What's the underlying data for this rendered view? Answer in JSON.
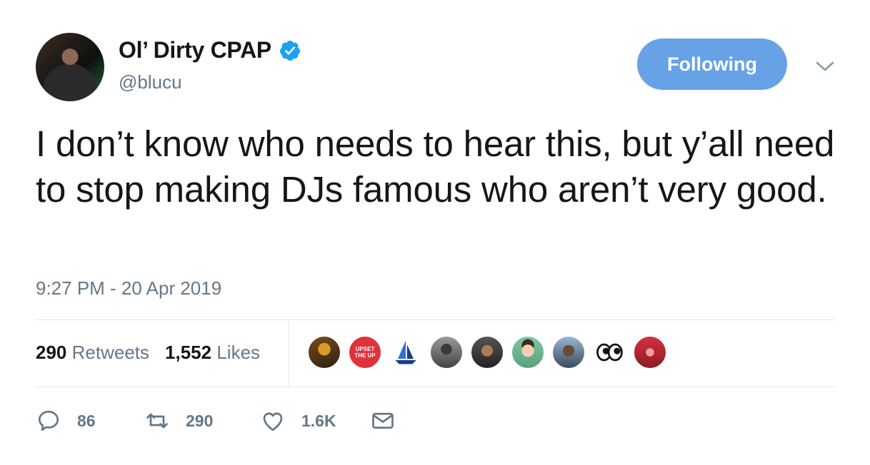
{
  "user": {
    "display_name": "Ol’ Dirty CPAP",
    "handle": "@blucu",
    "verified": true
  },
  "follow_button": {
    "label": "Following"
  },
  "tweet": {
    "text": "I don’t know who needs to hear this, but y’all need to stop making DJs famous who aren’t very good.",
    "timestamp": "9:27 PM - 20 Apr 2019"
  },
  "stats": {
    "retweets_count": "290",
    "retweets_label": "Retweets",
    "likes_count": "1,552",
    "likes_label": "Likes"
  },
  "likers": [
    {
      "icon": "avatar-crowd"
    },
    {
      "icon": "avatar-upset-the-up-logo",
      "text": "UPSET THE UP"
    },
    {
      "icon": "avatar-sailboat-logo"
    },
    {
      "icon": "avatar-person-1"
    },
    {
      "icon": "avatar-person-2"
    },
    {
      "icon": "avatar-cartoon-face"
    },
    {
      "icon": "avatar-person-3"
    },
    {
      "icon": "avatar-eyes"
    },
    {
      "icon": "avatar-red-logo"
    }
  ],
  "actions": {
    "reply_count": "86",
    "retweet_count": "290",
    "like_count": "1.6K"
  },
  "colors": {
    "accent": "#1da1f2",
    "follow_button_bg": "#67a1e6",
    "secondary_text": "#657786",
    "divider": "#e1e8ed"
  }
}
